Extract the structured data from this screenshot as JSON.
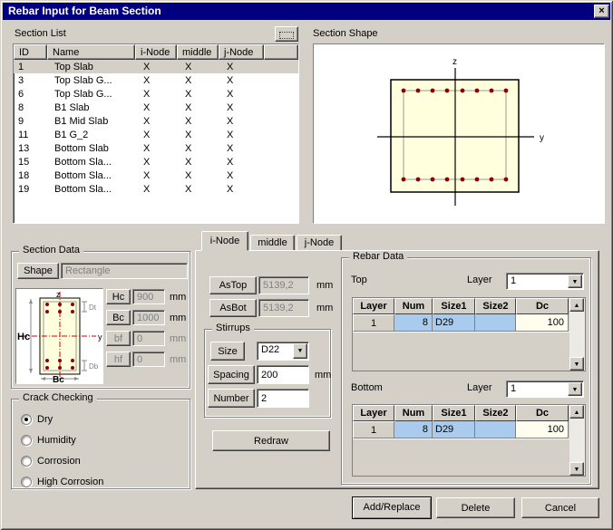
{
  "window": {
    "title": "Rebar Input for Beam Section"
  },
  "icons": {
    "close": "×",
    "dropdown": "▼",
    "scroll_up": "▲",
    "scroll_down": "▼"
  },
  "section_list": {
    "label": "Section List",
    "columns": [
      "ID",
      "Name",
      "i-Node",
      "middle",
      "j-Node"
    ],
    "rows": [
      {
        "id": "1",
        "name": "Top Slab",
        "i_node": "X",
        "middle": "X",
        "j_node": "X"
      },
      {
        "id": "3",
        "name": "Top Slab G...",
        "i_node": "X",
        "middle": "X",
        "j_node": "X"
      },
      {
        "id": "6",
        "name": "Top Slab G...",
        "i_node": "X",
        "middle": "X",
        "j_node": "X"
      },
      {
        "id": "8",
        "name": "B1 Slab",
        "i_node": "X",
        "middle": "X",
        "j_node": "X"
      },
      {
        "id": "9",
        "name": "B1 Mid Slab",
        "i_node": "X",
        "middle": "X",
        "j_node": "X"
      },
      {
        "id": "11",
        "name": "B1 G_2",
        "i_node": "X",
        "middle": "X",
        "j_node": "X"
      },
      {
        "id": "13",
        "name": "Bottom Slab",
        "i_node": "X",
        "middle": "X",
        "j_node": "X"
      },
      {
        "id": "15",
        "name": "Bottom Sla...",
        "i_node": "X",
        "middle": "X",
        "j_node": "X"
      },
      {
        "id": "18",
        "name": "Bottom Sla...",
        "i_node": "X",
        "middle": "X",
        "j_node": "X"
      },
      {
        "id": "19",
        "name": "Bottom Sla...",
        "i_node": "X",
        "middle": "X",
        "j_node": "X"
      }
    ],
    "selected_id": "1"
  },
  "section_shape": {
    "label": "Section Shape",
    "axis_vertical": "z",
    "axis_horizontal": "y"
  },
  "section_data": {
    "label": "Section Data",
    "shape_label": "Shape",
    "shape_value": "Rectangle",
    "diagram": {
      "axis_vertical": "z",
      "axis_horizontal": "y",
      "height_label": "Hc",
      "width_label": "Bc",
      "top_cover_label": "Dt",
      "bottom_cover_label": "Db"
    },
    "fields": [
      {
        "label": "Hc",
        "value": "900",
        "unit": "mm"
      },
      {
        "label": "Bc",
        "value": "1000",
        "unit": "mm"
      },
      {
        "label": "bf",
        "value": "0",
        "unit": "mm"
      },
      {
        "label": "hf",
        "value": "0",
        "unit": "mm"
      }
    ]
  },
  "crack_checking": {
    "label": "Crack Checking",
    "options": [
      {
        "label": "Dry",
        "selected": true
      },
      {
        "label": "Humidity",
        "selected": false
      },
      {
        "label": "Corrosion",
        "selected": false
      },
      {
        "label": "High Corrosion",
        "selected": false
      }
    ]
  },
  "tabs": [
    {
      "label": "i-Node",
      "active": true
    },
    {
      "label": "middle",
      "active": false
    },
    {
      "label": "j-Node",
      "active": false
    }
  ],
  "node_panel": {
    "as_top": {
      "label": "AsTop",
      "value": "5139,2",
      "unit": "mm"
    },
    "as_bot": {
      "label": "AsBot",
      "value": "5139,2",
      "unit": "mm"
    },
    "stirrups": {
      "label": "Stirrups",
      "size_label": "Size",
      "size_value": "D22",
      "spacing_label": "Spacing",
      "spacing_value": "200",
      "spacing_unit": "mm",
      "number_label": "Number",
      "number_value": "2"
    },
    "redraw": "Redraw"
  },
  "rebar_data": {
    "label": "Rebar Data",
    "columns": [
      "Layer",
      "Num",
      "Size1",
      "Size2",
      "Dc"
    ],
    "top": {
      "label": "Top",
      "layer_label": "Layer",
      "layer_value": "1",
      "row": {
        "layer": "1",
        "num": "8",
        "size1": "D29",
        "size2": "",
        "dc": "100"
      }
    },
    "bottom": {
      "label": "Bottom",
      "layer_label": "Layer",
      "layer_value": "1",
      "row": {
        "layer": "1",
        "num": "8",
        "size1": "D29",
        "size2": "",
        "dc": "100"
      }
    }
  },
  "footer": {
    "add_replace": "Add/Replace",
    "delete": "Delete",
    "cancel": "Cancel"
  },
  "colors": {
    "titlebar": "#000080",
    "cell_blue": "#a9cbee",
    "cell_cream": "#fffdee",
    "rebar_dot": "#900000",
    "section_fill": "#ffffde"
  }
}
